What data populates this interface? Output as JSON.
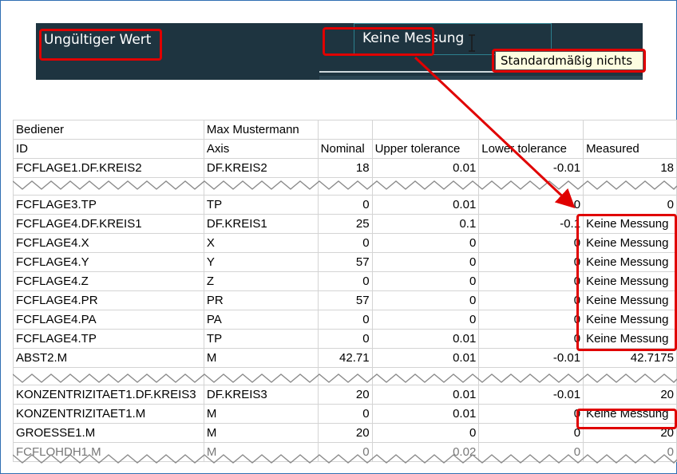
{
  "top": {
    "invalid_value_label": "Ungültiger Wert",
    "field_value": "Keine Messung",
    "tooltip": "Standardmäßig nichts"
  },
  "table": {
    "rows": [
      [
        "Bediener",
        "Max Mustermann",
        "",
        "",
        "",
        ""
      ],
      [
        "ID",
        "Axis",
        "Nominal",
        "Upper tolerance",
        "Lower tolerance",
        "Measured"
      ],
      [
        "FCFLAGE1.DF.KREIS2",
        "DF.KREIS2",
        "18",
        "0.01",
        "-0.01",
        "18"
      ],
      [
        "FCFLAGE3.TP",
        "TP",
        "0",
        "0.01",
        "0",
        "0"
      ],
      [
        "FCFLAGE4.DF.KREIS1",
        "DF.KREIS1",
        "25",
        "0.1",
        "-0.1",
        "Keine Messung"
      ],
      [
        "FCFLAGE4.X",
        "X",
        "0",
        "0",
        "0",
        "Keine Messung"
      ],
      [
        "FCFLAGE4.Y",
        "Y",
        "57",
        "0",
        "0",
        "Keine Messung"
      ],
      [
        "FCFLAGE4.Z",
        "Z",
        "0",
        "0",
        "0",
        "Keine Messung"
      ],
      [
        "FCFLAGE4.PR",
        "PR",
        "57",
        "0",
        "0",
        "Keine Messung"
      ],
      [
        "FCFLAGE4.PA",
        "PA",
        "0",
        "0",
        "0",
        "Keine Messung"
      ],
      [
        "FCFLAGE4.TP",
        "TP",
        "0",
        "0.01",
        "0",
        "Keine Messung"
      ],
      [
        "ABST2.M",
        "M",
        "42.71",
        "0.01",
        "-0.01",
        "42.7175"
      ],
      [
        "KONZENTRIZITAET1.DF.KREIS3",
        "DF.KREIS3",
        "20",
        "0.01",
        "-0.01",
        "20"
      ],
      [
        "KONZENTRIZITAET1.M",
        "M",
        "0",
        "0.01",
        "0",
        "Keine Messung"
      ],
      [
        "GROESSE1.M",
        "M",
        "20",
        "0",
        "0",
        "20"
      ],
      [
        "FCFLOHDH1.M",
        "M",
        "0",
        "0.02",
        "0",
        "0"
      ]
    ]
  },
  "colors": {
    "highlight": "#e00000",
    "strip": "#1e3440"
  }
}
